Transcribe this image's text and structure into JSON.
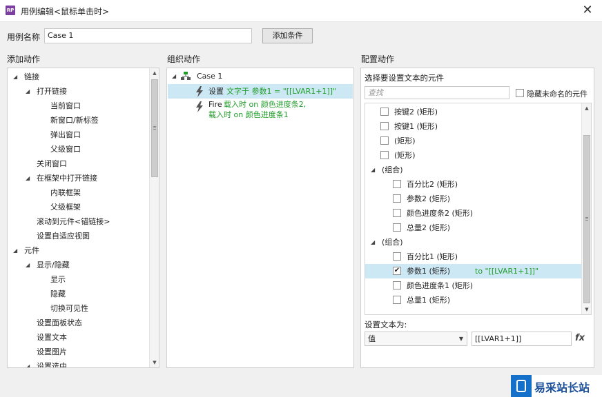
{
  "window": {
    "title": "用例编辑<鼠标单击时>",
    "app_icon": "RP"
  },
  "case_name": {
    "label": "用例名称",
    "value": "Case 1",
    "add_condition": "添加条件"
  },
  "headers": {
    "add_action": "添加动作",
    "organize_action": "组织动作",
    "configure_action": "配置动作"
  },
  "actions_tree": [
    {
      "label": "链接",
      "level": 0,
      "expanded": true
    },
    {
      "label": "打开链接",
      "level": 1,
      "expanded": true
    },
    {
      "label": "当前窗口",
      "level": 2
    },
    {
      "label": "新窗口/新标签",
      "level": 2
    },
    {
      "label": "弹出窗口",
      "level": 2
    },
    {
      "label": "父级窗口",
      "level": 2
    },
    {
      "label": "关闭窗口",
      "level": 1
    },
    {
      "label": "在框架中打开链接",
      "level": 1,
      "expanded": true
    },
    {
      "label": "内联框架",
      "level": 2
    },
    {
      "label": "父级框架",
      "level": 2
    },
    {
      "label": "滚动到元件<锚链接>",
      "level": 1
    },
    {
      "label": "设置自适应视图",
      "level": 1
    },
    {
      "label": "元件",
      "level": 0,
      "expanded": true
    },
    {
      "label": "显示/隐藏",
      "level": 1,
      "expanded": true
    },
    {
      "label": "显示",
      "level": 2
    },
    {
      "label": "隐藏",
      "level": 2
    },
    {
      "label": "切换可见性",
      "level": 2
    },
    {
      "label": "设置面板状态",
      "level": 1
    },
    {
      "label": "设置文本",
      "level": 1
    },
    {
      "label": "设置图片",
      "level": 1
    },
    {
      "label": "设置选中",
      "level": 1,
      "expanded": true
    }
  ],
  "organize": {
    "case_label": "Case 1",
    "action1": {
      "prefix": "设置",
      "detail": "文字于 参数1 = \"[[LVAR1+1]]\""
    },
    "action2": {
      "prefix": "Fire",
      "line1": "载入时 on 颜色进度条2,",
      "line2": "载入时 on 颜色进度条1"
    }
  },
  "configure": {
    "subtitle": "选择要设置文本的元件",
    "search_placeholder": "查找",
    "hide_unnamed": "隐藏未命名的元件",
    "widgets": [
      {
        "type": "item",
        "label": "按键2 (矩形)",
        "checked": false,
        "level": 0
      },
      {
        "type": "item",
        "label": "按键1 (矩形)",
        "checked": false,
        "level": 0
      },
      {
        "type": "item",
        "label": "(矩形)",
        "checked": false,
        "level": 0
      },
      {
        "type": "item",
        "label": "(矩形)",
        "checked": false,
        "level": 0
      },
      {
        "type": "group",
        "label": "(组合)"
      },
      {
        "type": "item",
        "label": "百分比2 (矩形)",
        "checked": false,
        "level": 1
      },
      {
        "type": "item",
        "label": "参数2 (矩形)",
        "checked": false,
        "level": 1
      },
      {
        "type": "item",
        "label": "颜色进度条2 (矩形)",
        "checked": false,
        "level": 1
      },
      {
        "type": "item",
        "label": "总量2 (矩形)",
        "checked": false,
        "level": 1
      },
      {
        "type": "group",
        "label": "(组合)"
      },
      {
        "type": "item",
        "label": "百分比1 (矩形)",
        "checked": false,
        "level": 1
      },
      {
        "type": "item",
        "label": "参数1 (矩形)",
        "suffix": "to \"[[LVAR1+1]]\"",
        "checked": true,
        "level": 1,
        "selected": true
      },
      {
        "type": "item",
        "label": "颜色进度条1 (矩形)",
        "checked": false,
        "level": 1
      },
      {
        "type": "item",
        "label": "总量1 (矩形)",
        "checked": false,
        "level": 1
      }
    ],
    "set_text_label": "设置文本为:",
    "value_type": "值",
    "value": "[[LVAR1+1]]",
    "fx": "fx"
  },
  "watermark": {
    "text": "易采站长站"
  },
  "colors": {
    "selection": "#cce8f4",
    "action_green": "#1f9b28",
    "bolt_gray": "#555555"
  }
}
